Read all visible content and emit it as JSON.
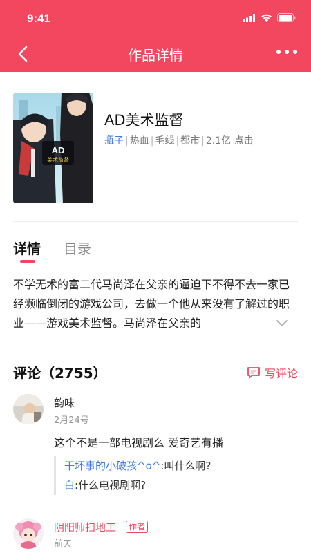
{
  "status_bar": {
    "time": "9:41"
  },
  "nav": {
    "title": "作品详情"
  },
  "work": {
    "title": "AD美术监督",
    "author": "瓶子",
    "tags": [
      "热血",
      "毛线",
      "都市"
    ],
    "views": "2.1亿 点击",
    "cover_text_logo": "AD",
    "cover_text_sub": "美术监督"
  },
  "tabs": {
    "details": "详情",
    "toc": "目录"
  },
  "synopsis": "不学无术的富二代马尚泽在父亲的逼迫下不得不去一家已经濒临倒闭的游戏公司，去做一个他从来没有了解过的职业——游戏美术监督。马尚泽在父亲的",
  "comments": {
    "heading": "评论（2755）",
    "write_label": "写评论",
    "items": [
      {
        "name": "韵味",
        "date": "2月24号",
        "body": "这个不是一部电视剧么 爱奇艺有播",
        "replies": [
          {
            "name": "干坏事的小破孩^o^",
            "text": ":叫什么啊?"
          },
          {
            "name": "白",
            "text": ":什么电视剧啊?"
          }
        ]
      },
      {
        "name": "阴阳师扫地工",
        "badge": "作者",
        "date": "前天"
      }
    ]
  },
  "colors": {
    "accent": "#f2475f",
    "link": "#3d7be4"
  }
}
